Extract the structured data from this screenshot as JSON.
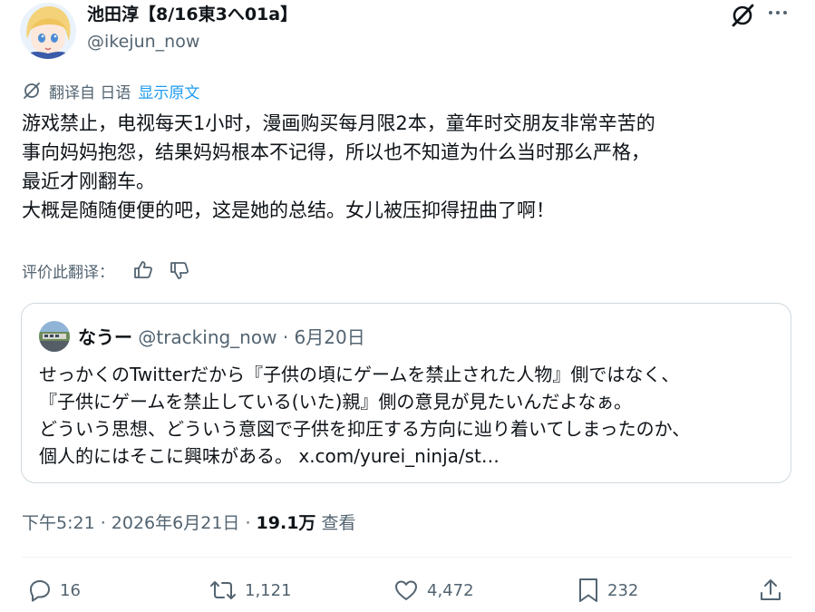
{
  "author": {
    "name": "池田淳【8/16東3へ01a】",
    "handle": "@ikejun_now"
  },
  "translation": {
    "from_label": "翻译自 日语",
    "show_original": "显示原文"
  },
  "tweet": {
    "lines": [
      "游戏禁止，电视每天1小时，漫画购买每月限2本，童年时交朋友非常辛苦的",
      "事向妈妈抱怨，结果妈妈根本不记得，所以也不知道为什么当时那么严格，",
      "最近才刚翻车。",
      "大概是随随便便的吧，这是她的总结。女儿被压抑得扭曲了啊！"
    ]
  },
  "rate": {
    "label": "评价此翻译："
  },
  "quote": {
    "name": "なうー",
    "handle": "@tracking_now",
    "separator": "·",
    "date": "6月20日",
    "lines": [
      "せっかくのTwitterだから『子供の頃にゲームを禁止された人物』側ではなく、",
      "『子供にゲームを禁止している(いた)親』側の意見が見たいんだよなぁ。",
      "どういう思想、どういう意図で子供を抑圧する方向に辿り着いてしまったのか、",
      "個人的にはそこに興味がある。 x.com/yurei_ninja/st…"
    ]
  },
  "meta": {
    "time": "下午5:21 · 2026年6月21日 · ",
    "views": "19.1万",
    "views_label": " 查看"
  },
  "actions": {
    "replies": "16",
    "retweets": "1,121",
    "likes": "4,472",
    "bookmarks": "232"
  },
  "icons": {
    "grok": "grok-icon",
    "more": "more-icon",
    "translate": "translate-icon",
    "thumbs_up": "thumbs-up-icon",
    "thumbs_down": "thumbs-down-icon",
    "reply": "reply-icon",
    "retweet": "retweet-icon",
    "like": "heart-icon",
    "bookmark": "bookmark-icon",
    "share": "share-icon"
  },
  "colors": {
    "text": "#0f1419",
    "secondary": "#536471",
    "link": "#1d9bf0",
    "border": "#cfd9de"
  }
}
